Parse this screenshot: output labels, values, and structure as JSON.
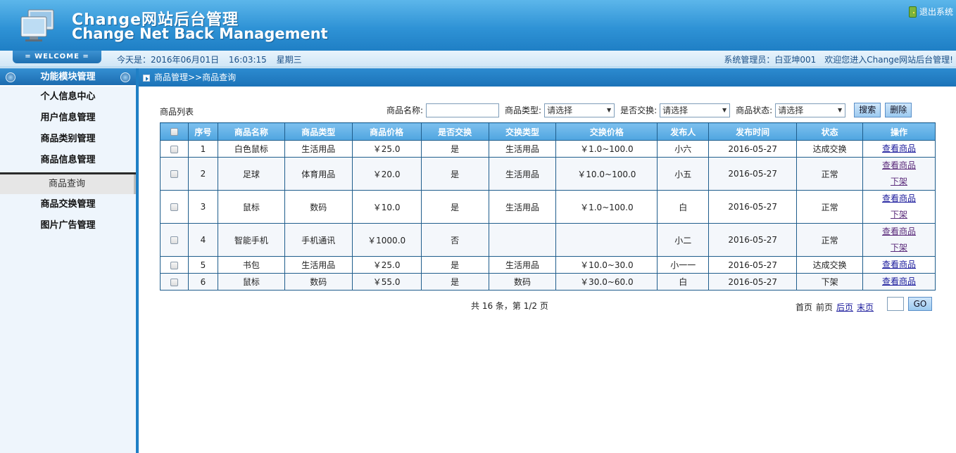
{
  "header": {
    "title_cn": "Change网站后台管理",
    "title_en": "Change Net Back Management",
    "logout": "退出系统",
    "logo_icon": "computer-monitor-icon",
    "logout_icon": "exit-door-icon"
  },
  "statusbar": {
    "welcome": "= WELCOME =",
    "today_label": "今天是：2016年06月01日",
    "time": "16:03:15",
    "weekday": "星期三",
    "admin_info": "系统管理员：白亚坤001　欢迎您进入Change网站后台管理!"
  },
  "sidebar": {
    "heading": "功能模块管理",
    "items": [
      "个人信息中心",
      "用户信息管理",
      "商品类别管理",
      "商品信息管理"
    ],
    "sub_item": "商品查询",
    "items_after": [
      "商品交换管理",
      "图片广告管理"
    ]
  },
  "breadcrumb": "商品管理>>商品查询",
  "list_title": "商品列表",
  "filters": {
    "name_label": "商品名称:",
    "type_label": "商品类型:",
    "type_value": "请选择",
    "exchange_label": "是否交换:",
    "exchange_value": "请选择",
    "status_label": "商品状态:",
    "status_value": "请选择",
    "search_button": "搜索",
    "delete_button": "删除"
  },
  "table": {
    "headers": [
      "序号",
      "商品名称",
      "商品类型",
      "商品价格",
      "是否交换",
      "交换类型",
      "交换价格",
      "发布人",
      "发布时间",
      "状态",
      "操作"
    ],
    "rows": [
      {
        "no": "1",
        "name": "白色鼠标",
        "type": "生活用品",
        "price": "￥25.0",
        "exchange": "是",
        "ex_type": "生活用品",
        "ex_price": "￥1.0~100.0",
        "publisher": "小六",
        "date": "2016-05-27",
        "status": "达成交换",
        "ops": [
          "查看商品"
        ]
      },
      {
        "no": "2",
        "name": "足球",
        "type": "体育用品",
        "price": "￥20.0",
        "exchange": "是",
        "ex_type": "生活用品",
        "ex_price": "￥10.0~100.0",
        "publisher": "小五",
        "date": "2016-05-27",
        "status": "正常",
        "ops": [
          "查看商品",
          "下架"
        ]
      },
      {
        "no": "3",
        "name": "鼠标",
        "type": "数码",
        "price": "￥10.0",
        "exchange": "是",
        "ex_type": "生活用品",
        "ex_price": "￥1.0~100.0",
        "publisher": "白",
        "date": "2016-05-27",
        "status": "正常",
        "ops": [
          "查看商品",
          "下架"
        ]
      },
      {
        "no": "4",
        "name": "智能手机",
        "type": "手机通讯",
        "price": "￥1000.0",
        "exchange": "否",
        "ex_type": "",
        "ex_price": "",
        "publisher": "小二",
        "date": "2016-05-27",
        "status": "正常",
        "ops": [
          "查看商品",
          "下架"
        ]
      },
      {
        "no": "5",
        "name": "书包",
        "type": "生活用品",
        "price": "￥25.0",
        "exchange": "是",
        "ex_type": "生活用品",
        "ex_price": "￥10.0~30.0",
        "publisher": "小一一",
        "date": "2016-05-27",
        "status": "达成交换",
        "ops": [
          "查看商品"
        ]
      },
      {
        "no": "6",
        "name": "鼠标",
        "type": "数码",
        "price": "￥55.0",
        "exchange": "是",
        "ex_type": "数码",
        "ex_price": "￥30.0~60.0",
        "publisher": "白",
        "date": "2016-05-27",
        "status": "下架",
        "ops": [
          "查看商品"
        ]
      }
    ]
  },
  "pager": {
    "summary": "共 16 条，第 1/2 页",
    "first": "首页",
    "prev": "前页",
    "next": "后页",
    "last": "末页",
    "go": "GO"
  }
}
